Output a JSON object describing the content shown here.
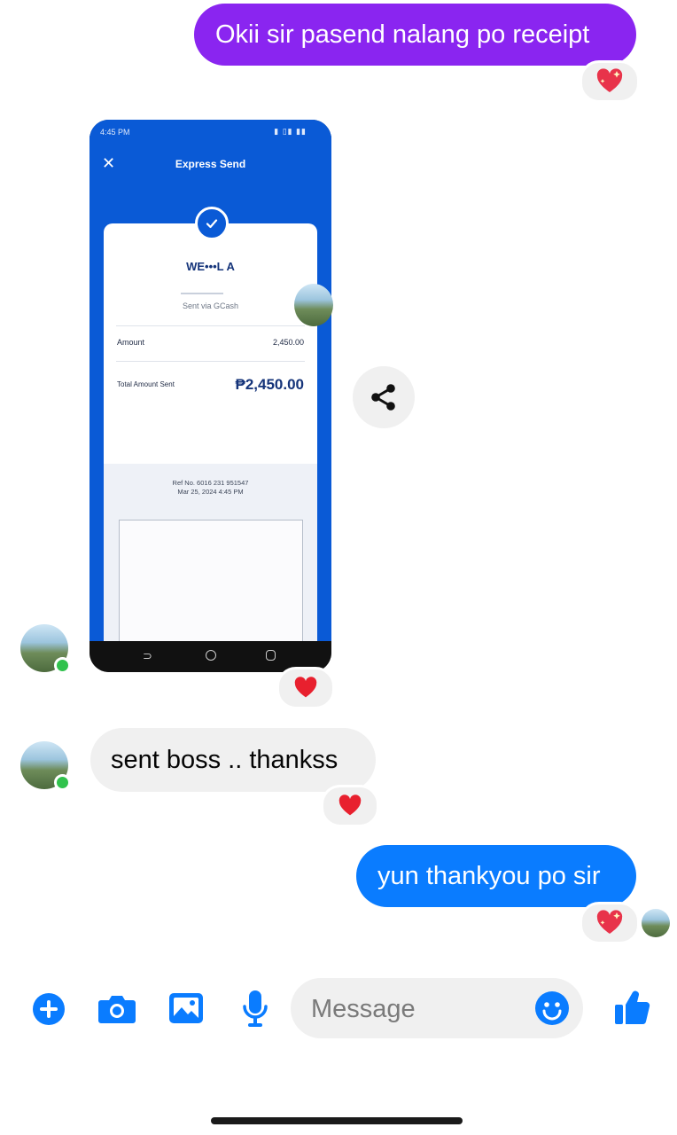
{
  "messages": {
    "m1": {
      "text": "Okii sir pasend nalang po receipt",
      "sender": "me",
      "reaction": "heart-with-sparkles"
    },
    "m2": {
      "type": "image",
      "sender": "them",
      "reaction": "red-heart"
    },
    "m3": {
      "text": "sent boss .. thankss",
      "sender": "them",
      "reaction": "red-heart"
    },
    "m4": {
      "text": "yun thankyou po sir",
      "sender": "me",
      "reaction": "heart-with-sparkles"
    }
  },
  "receipt": {
    "status_time": "4:45 PM",
    "header_title": "Express Send",
    "recipient": "WE•••L A",
    "sent_via": "Sent via GCash",
    "amount_label": "Amount",
    "amount_value": "2,450.00",
    "total_label": "Total Amount Sent",
    "total_value": "₱2,450.00",
    "ref_no": "Ref No. 6016 231 951547",
    "date": "Mar 25, 2024 4:45 PM"
  },
  "composer": {
    "placeholder": "Message",
    "icons": [
      "plus-circle-icon",
      "camera-icon",
      "gallery-icon",
      "microphone-icon",
      "emoji-icon",
      "thumbs-up-icon"
    ]
  },
  "colors": {
    "purple_bubble": "#8a25f0",
    "blue_bubble": "#0a7cff",
    "incoming_bubble": "#f0f0f0",
    "accent": "#0a7cff"
  }
}
